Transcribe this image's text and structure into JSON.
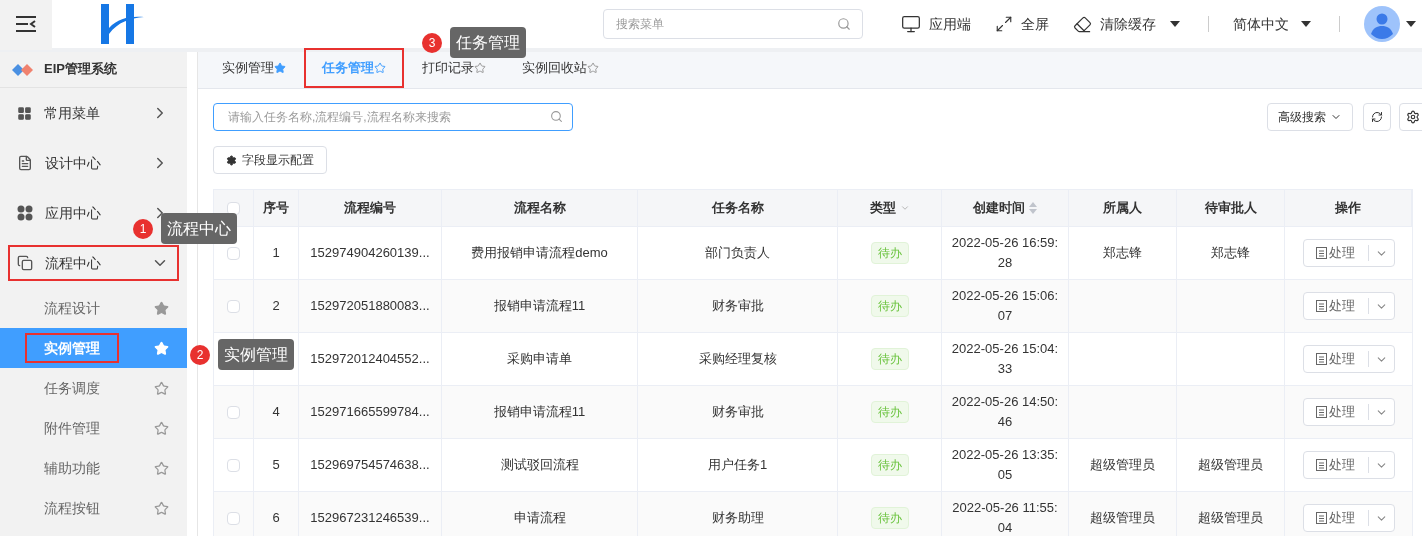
{
  "header": {
    "search": {
      "placeholder": "搜索菜单"
    },
    "actions": [
      {
        "kind": "monitor",
        "label": "应用端",
        "dropdown": false
      },
      {
        "kind": "fullscreen",
        "label": "全屏",
        "dropdown": false
      },
      {
        "kind": "clear",
        "label": "清除缓存",
        "dropdown": true
      }
    ],
    "language": "简体中文"
  },
  "sidebar": {
    "title": "EIP管理系统",
    "items": [
      {
        "kind": "grid",
        "label": "常用菜单",
        "expanded": false,
        "highlighted": false
      },
      {
        "kind": "design",
        "label": "设计中心",
        "expanded": false,
        "highlighted": false
      },
      {
        "kind": "apps",
        "label": "应用中心",
        "expanded": false,
        "highlighted": false
      },
      {
        "kind": "flow",
        "label": "流程中心",
        "expanded": true,
        "highlighted": true,
        "children": [
          {
            "label": "流程设计",
            "selected": false,
            "favorite": true,
            "highlighted": false
          },
          {
            "label": "实例管理",
            "selected": true,
            "favorite": true,
            "highlighted": true
          },
          {
            "label": "任务调度",
            "selected": false,
            "favorite": false,
            "highlighted": false
          },
          {
            "label": "附件管理",
            "selected": false,
            "favorite": false,
            "highlighted": false
          },
          {
            "label": "辅助功能",
            "selected": false,
            "favorite": false,
            "highlighted": false
          },
          {
            "label": "流程按钮",
            "selected": false,
            "favorite": false,
            "highlighted": false
          }
        ]
      }
    ]
  },
  "tabs": [
    {
      "label": "实例管理",
      "selected": false,
      "favorite": true,
      "highlighted": false
    },
    {
      "label": "任务管理",
      "selected": true,
      "favorite": false,
      "highlighted": true
    },
    {
      "label": "打印记录",
      "selected": false,
      "favorite": false,
      "highlighted": false
    },
    {
      "label": "实例回收站",
      "selected": false,
      "favorite": false,
      "highlighted": false
    }
  ],
  "toolbar": {
    "search": {
      "placeholder": "请输入任务名称,流程编号,流程名称来搜索"
    },
    "field_config": "字段显示配置",
    "advanced_search": "高级搜索"
  },
  "table": {
    "all_checked": false,
    "columns": [
      "序号",
      "流程编号",
      "流程名称",
      "任务名称",
      "类型",
      "创建时间",
      "所属人",
      "待审批人",
      "操作"
    ],
    "rows": [
      {
        "checked": false,
        "seq": "1",
        "code": "152974904260139...",
        "flow": "费用报销申请流程demo",
        "task": "部门负责人",
        "type": "待办",
        "created": "2022-05-26 16:59:28",
        "owner": "郑志锋",
        "approver": "郑志锋",
        "action": "处理"
      },
      {
        "checked": false,
        "seq": "2",
        "code": "152972051880083...",
        "flow": "报销申请流程11",
        "task": "财务审批",
        "type": "待办",
        "created": "2022-05-26 15:06:07",
        "action": "处理"
      },
      {
        "code": "152972012404552...",
        "flow": "采购申请单",
        "task": "采购经理复核",
        "type": "待办",
        "created": "2022-05-26 15:04:33",
        "action": "处理"
      },
      {
        "checked": false,
        "seq": "4",
        "code": "152971665599784...",
        "flow": "报销申请流程11",
        "task": "财务审批",
        "type": "待办",
        "created": "2022-05-26 14:50:46",
        "action": "处理"
      },
      {
        "checked": false,
        "seq": "5",
        "code": "152969754574638...",
        "flow": "测试驳回流程",
        "task": "用户任务1",
        "type": "待办",
        "created": "2022-05-26 13:35:05",
        "owner": "超级管理员",
        "approver": "超级管理员",
        "action": "处理"
      },
      {
        "checked": false,
        "seq": "6",
        "code": "152967231246539...",
        "flow": "申请流程",
        "task": "财务助理",
        "type": "待办",
        "created": "2022-05-26 11:55:04",
        "owner": "超级管理员",
        "approver": "超级管理员",
        "action": "处理"
      }
    ]
  },
  "callouts": [
    {
      "number": "1",
      "label": "流程中心"
    },
    {
      "number": "2",
      "label": "实例管理"
    },
    {
      "number": "3",
      "label": "任务管理"
    }
  ]
}
